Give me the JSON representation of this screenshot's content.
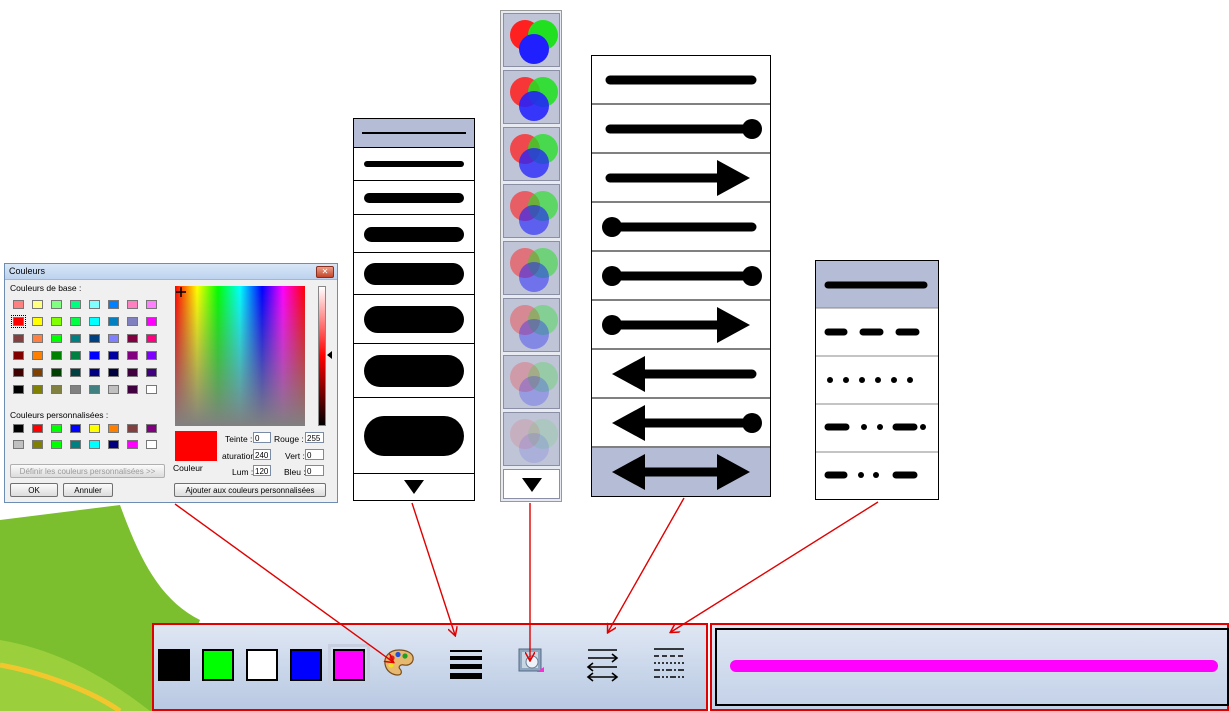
{
  "dialog": {
    "title": "Couleurs",
    "close_glyph": "✕",
    "basic_colors_label": "Couleurs de base :",
    "basic_colors": [
      "#ff8080",
      "#ffff80",
      "#80ff80",
      "#00ff80",
      "#80ffff",
      "#0080ff",
      "#ff80c0",
      "#ff80ff",
      "#ff0000",
      "#ffff00",
      "#80ff00",
      "#00ff40",
      "#00ffff",
      "#0080c0",
      "#8080c0",
      "#ff00ff",
      "#804040",
      "#ff8040",
      "#00ff00",
      "#008080",
      "#004080",
      "#8080ff",
      "#800040",
      "#ff0080",
      "#800000",
      "#ff8000",
      "#008000",
      "#008040",
      "#0000ff",
      "#0000a0",
      "#800080",
      "#8000ff",
      "#400000",
      "#804000",
      "#004000",
      "#004040",
      "#000080",
      "#000040",
      "#400040",
      "#400080",
      "#000000",
      "#808000",
      "#808040",
      "#808080",
      "#408080",
      "#c0c0c0",
      "#400040",
      "#ffffff"
    ],
    "custom_colors_label": "Couleurs personnalisées :",
    "custom_colors": [
      "#000000",
      "#ff0000",
      "#00ff00",
      "#0000ff",
      "#ffff00",
      "#ff8000",
      "#804040",
      "#800080",
      "#c0c0c0",
      "#808000",
      "#00ff00",
      "#008080",
      "#00ffff",
      "#000080",
      "#ff00ff",
      "#ffffff"
    ],
    "define_custom_button": "Définir les couleurs personnalisées >>",
    "ok_button": "OK",
    "cancel_button": "Annuler",
    "add_custom_button": "Ajouter aux couleurs personnalisées",
    "color_label": "Couleur",
    "current_color": "#ff0000",
    "fields": {
      "teinte_label": "Teinte :",
      "teinte_value": "0",
      "saturation_label": "aturation",
      "saturation_value": "240",
      "lum_label": "Lum :",
      "lum_value": "120",
      "rouge_label": "Rouge :",
      "rouge_value": "255",
      "vert_label": "Vert :",
      "vert_value": "0",
      "bleu_label": "Bleu :",
      "bleu_value": "0"
    }
  },
  "line_width_menu": {
    "items": [
      "thinnest",
      "w1",
      "w2",
      "w3",
      "w4",
      "w5",
      "w6",
      "w7"
    ],
    "selected_index": 0,
    "more_icon": "down-triangle-icon"
  },
  "opacity_menu": {
    "levels": [
      1.0,
      0.87,
      0.75,
      0.62,
      0.5,
      0.37,
      0.25,
      0.12
    ],
    "more_icon": "down-triangle-icon"
  },
  "arrow_menu": {
    "items": [
      "plain-line",
      "line-dot-end",
      "line-arrow-end",
      "dot-line",
      "dot-line-dot",
      "dot-line-arrow",
      "arrow-line",
      "arrow-line-dot",
      "arrow-both"
    ],
    "selected_index": 8
  },
  "dash_menu": {
    "items": [
      "solid",
      "dash",
      "dot",
      "dash-dot",
      "dash-dot-dot"
    ],
    "selected_index": 0
  },
  "toolbar": {
    "colors": [
      "#000000",
      "#00ff00",
      "#ffffff",
      "#0000ff",
      "#ff00ff"
    ],
    "selected_color_index": 4,
    "icons": [
      "palette-icon",
      "line-width-icon",
      "opacity-icon",
      "arrow-style-icon",
      "dash-style-icon"
    ]
  },
  "preview": {
    "line_color": "#ff00ff"
  },
  "accent": {
    "annotation_red": "#e00000",
    "menu_selected": "#b5bcd6"
  }
}
